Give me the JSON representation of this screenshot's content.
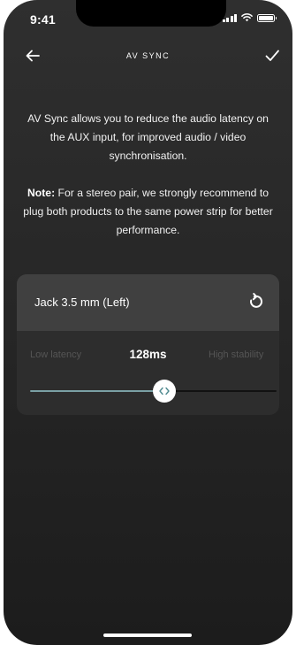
{
  "status_bar": {
    "time": "9:41"
  },
  "nav": {
    "title": "AV SYNC"
  },
  "description": "AV Sync allows you to reduce the audio latency on the AUX input, for improved audio / video synchronisation.",
  "note": {
    "label": "Note:",
    "text": " For a stereo pair, we strongly recommend to plug both products to the same power strip for better performance."
  },
  "card": {
    "title": "Jack 3.5 mm (Left)",
    "low_label": "Low latency",
    "latency_value": "128ms",
    "high_label": "High stability",
    "slider_fraction": 0.545
  },
  "colors": {
    "accent": "#7aa0a4",
    "background": "#282828",
    "card": "#2d2d2d",
    "card_header": "#404040"
  },
  "icons": [
    "back-arrow-icon",
    "checkmark-icon",
    "reset-icon",
    "chevron-left-right-icon"
  ]
}
